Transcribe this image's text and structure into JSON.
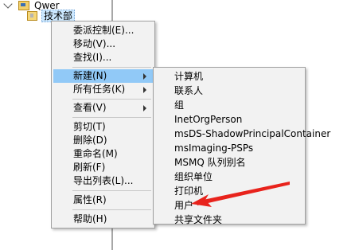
{
  "tree": {
    "domain_label": "Qwer",
    "ou_label": "技术部"
  },
  "context_menu": {
    "items": [
      {
        "label": "委派控制(E)..."
      },
      {
        "label": "移动(V)..."
      },
      {
        "label": "查找(I)..."
      },
      {
        "label": "新建(N)"
      },
      {
        "label": "所有任务(K)"
      },
      {
        "label": "查看(V)"
      },
      {
        "label": "剪切(T)"
      },
      {
        "label": "删除(D)"
      },
      {
        "label": "重命名(M)"
      },
      {
        "label": "刷新(F)"
      },
      {
        "label": "导出列表(L)..."
      },
      {
        "label": "属性(R)"
      },
      {
        "label": "帮助(H)"
      }
    ]
  },
  "submenu": {
    "items": [
      {
        "label": "计算机"
      },
      {
        "label": "联系人"
      },
      {
        "label": "组"
      },
      {
        "label": "InetOrgPerson"
      },
      {
        "label": "msDS-ShadowPrincipalContainer"
      },
      {
        "label": "msImaging-PSPs"
      },
      {
        "label": "MSMQ 队列别名"
      },
      {
        "label": "组织单位"
      },
      {
        "label": "打印机"
      },
      {
        "label": "用户"
      },
      {
        "label": "共享文件夹"
      }
    ]
  },
  "annotation": {
    "arrow_color": "#e8231c",
    "points_to": "用户"
  },
  "colors": {
    "highlight": "#91c9f7",
    "menu_bg": "#f2f2f2"
  }
}
